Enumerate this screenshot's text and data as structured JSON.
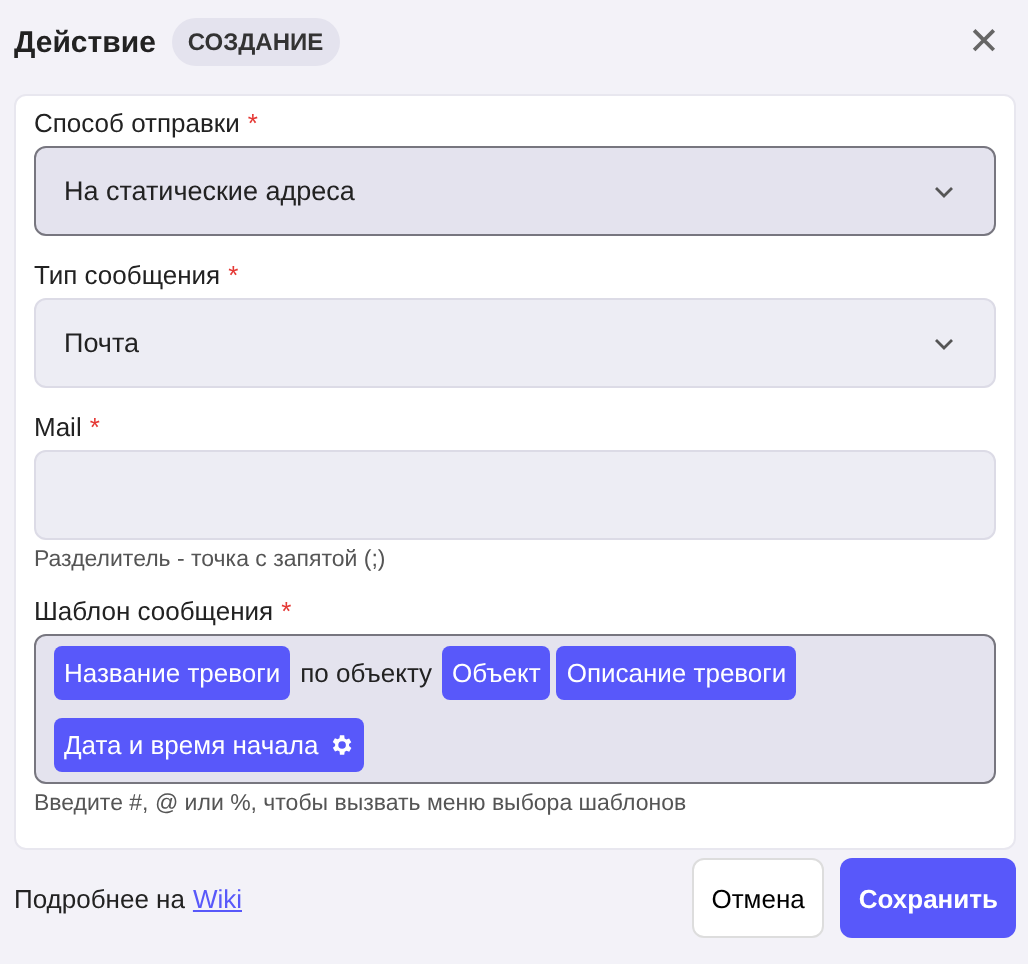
{
  "header": {
    "title": "Действие",
    "badge": "СОЗДАНИЕ",
    "close": "✕"
  },
  "fields": [
    {
      "kind": "select",
      "label": "Способ отправки",
      "required_mark": "*",
      "value": "На статические адреса",
      "focused": true
    },
    {
      "kind": "select",
      "label": "Тип сообщения",
      "required_mark": "*",
      "value": "Почта",
      "focused": false
    },
    {
      "kind": "input",
      "label": "Mail",
      "required_mark": "*",
      "hint": "Разделитель - точка с запятой (;)",
      "focused": false
    },
    {
      "kind": "template",
      "label": "Шаблон сообщения",
      "required_mark": "*",
      "focused": true,
      "hint": "Введите #, @ или %, чтобы вызвать меню выбора шаблонов",
      "segments": [
        {
          "kind": "tag",
          "text": "Название тревоги",
          "icon": false
        },
        {
          "kind": "text",
          "text": "по объекту"
        },
        {
          "kind": "tag",
          "text": "Объект",
          "icon": false
        },
        {
          "kind": "tag",
          "text": "Описание тревоги",
          "icon": false
        },
        {
          "kind": "tag",
          "text": "Дата и время начала",
          "icon": true
        }
      ]
    }
  ],
  "footer": {
    "more": "Подробнее на",
    "link": "Wiki",
    "cancel": "Отмена",
    "save": "Сохранить"
  }
}
